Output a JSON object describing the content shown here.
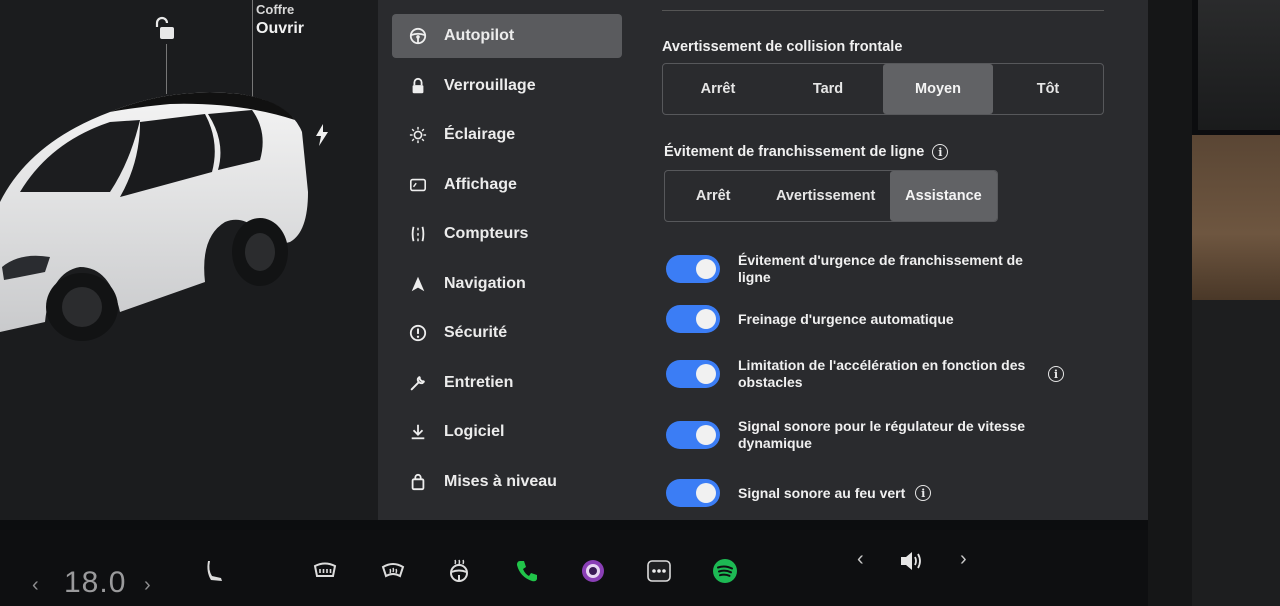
{
  "car": {
    "trunk_label": "Coffre",
    "trunk_action": "Ouvrir"
  },
  "menu": {
    "items": [
      {
        "label": "Autopilot",
        "icon": "steering-wheel-icon",
        "active": true
      },
      {
        "label": "Verrouillage",
        "icon": "lock-icon"
      },
      {
        "label": "Éclairage",
        "icon": "sun-icon"
      },
      {
        "label": "Affichage",
        "icon": "display-icon"
      },
      {
        "label": "Compteurs",
        "icon": "road-icon"
      },
      {
        "label": "Navigation",
        "icon": "navigation-arrow-icon"
      },
      {
        "label": "Sécurité",
        "icon": "alert-circle-icon"
      },
      {
        "label": "Entretien",
        "icon": "wrench-icon"
      },
      {
        "label": "Logiciel",
        "icon": "download-icon"
      },
      {
        "label": "Mises à niveau",
        "icon": "shopping-bag-icon"
      }
    ]
  },
  "autopilot": {
    "collision": {
      "title": "Avertissement de collision frontale",
      "options": [
        "Arrêt",
        "Tard",
        "Moyen",
        "Tôt"
      ],
      "selected": "Moyen"
    },
    "lane": {
      "title": "Évitement de franchissement de ligne",
      "options": [
        "Arrêt",
        "Avertissement",
        "Assistance"
      ],
      "selected": "Assistance"
    },
    "toggles": [
      {
        "label": "Évitement d'urgence de franchissement de ligne",
        "on": true,
        "info": false
      },
      {
        "label": "Freinage d'urgence automatique",
        "on": true,
        "info": false
      },
      {
        "label": "Limitation de l'accélération en fonction des obstacles",
        "on": true,
        "info": true
      },
      {
        "label": "Signal sonore pour le régulateur de vitesse dynamique",
        "on": true,
        "info": false
      },
      {
        "label": "Signal sonore au feu vert",
        "on": true,
        "info": true
      }
    ]
  },
  "bottom_bar": {
    "temperature": "18.0",
    "icons": [
      "seat-icon",
      "rear-defrost-icon",
      "front-defrost-icon",
      "heated-steering-icon",
      "phone-icon",
      "camera-icon",
      "more-icon",
      "spotify-icon",
      "volume-icon"
    ],
    "accent_green": "#1db954",
    "phone_green": "#21c44a"
  },
  "colors": {
    "toggle_on": "#3b7df5",
    "panel_bg": "#2a2b2e",
    "selected_bg": "#616265"
  }
}
